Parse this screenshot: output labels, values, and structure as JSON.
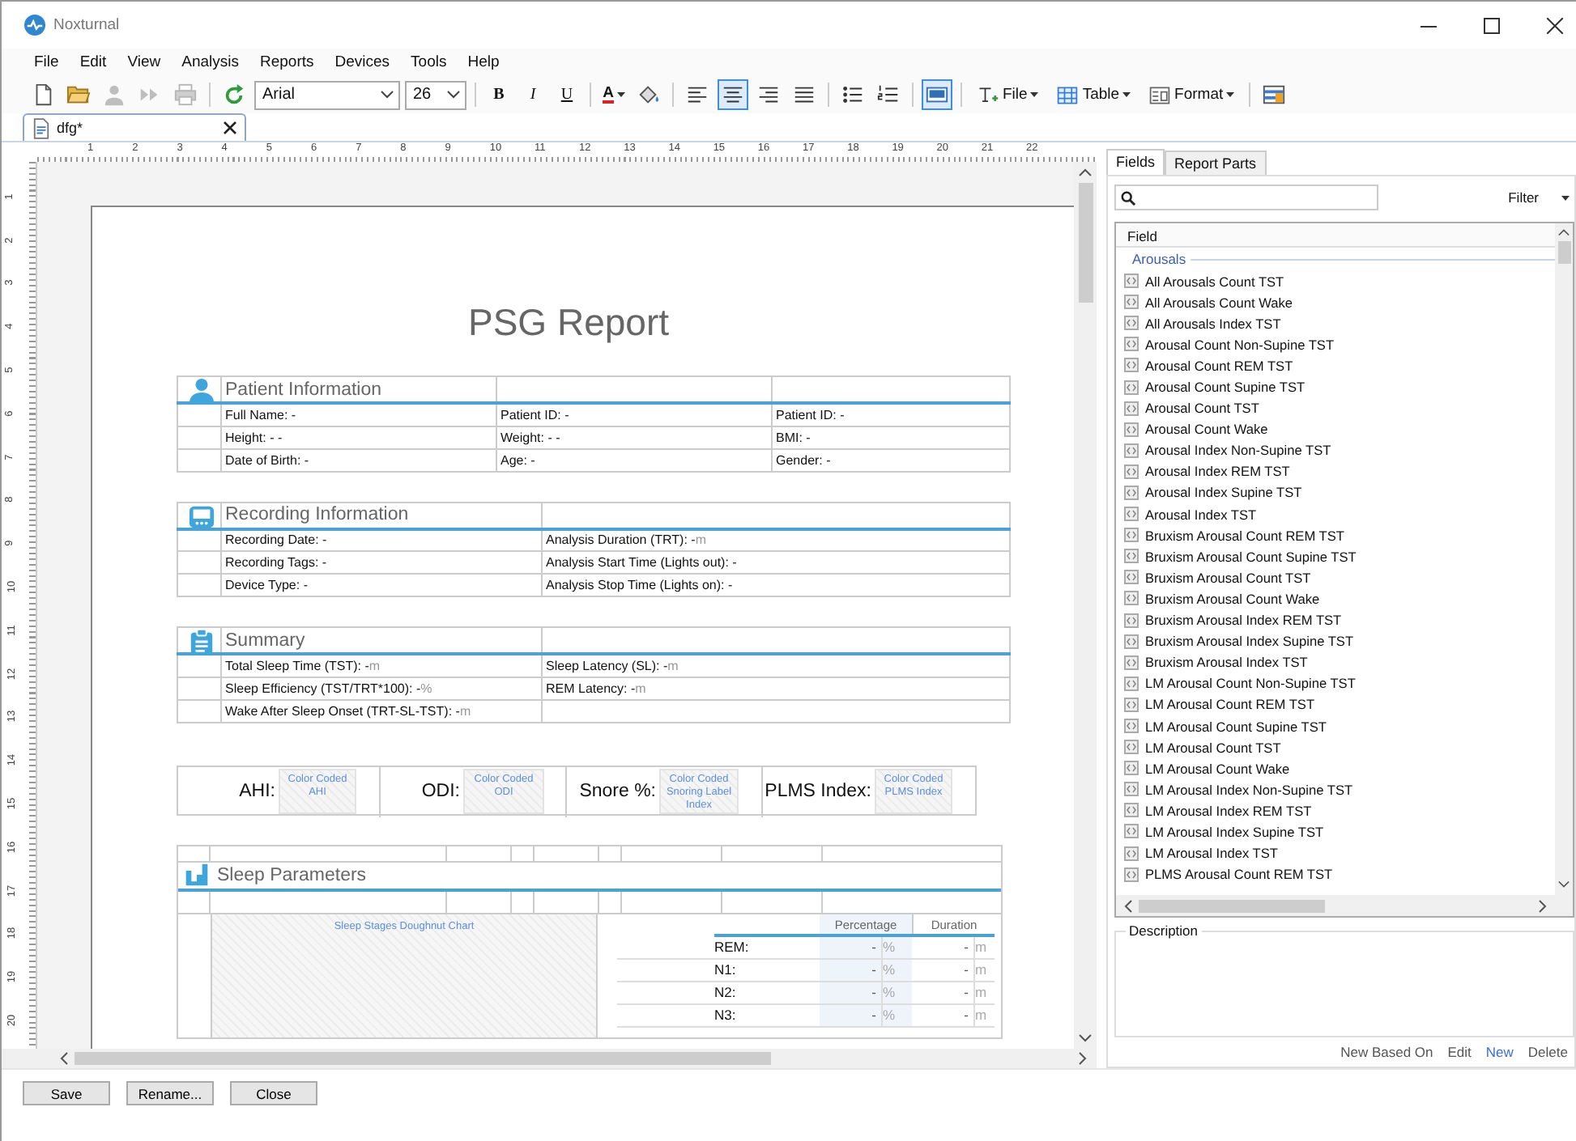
{
  "window": {
    "title": "Noxturnal"
  },
  "menu": [
    "File",
    "Edit",
    "View",
    "Analysis",
    "Reports",
    "Devices",
    "Tools",
    "Help"
  ],
  "toolbar": {
    "groups": [
      {
        "items": [
          {
            "kind": "new",
            "disabled": false
          },
          {
            "kind": "open",
            "disabled": false
          },
          {
            "kind": "person",
            "disabled": true
          },
          {
            "kind": "forward",
            "disabled": true
          },
          {
            "kind": "print",
            "disabled": true
          }
        ]
      },
      {
        "items": [
          {
            "kind": "redo",
            "disabled": false
          },
          {
            "kind": "select",
            "value": "Arial"
          },
          {
            "kind": "size",
            "value": "26"
          }
        ]
      },
      {
        "items": [
          {
            "kind": "bold",
            "label": "B"
          },
          {
            "kind": "italic",
            "label": "I"
          },
          {
            "kind": "underline",
            "label": "U"
          }
        ]
      },
      {
        "items": [
          {
            "kind": "color",
            "label": "A"
          },
          {
            "kind": "fill",
            "disabled": false
          }
        ]
      },
      {
        "items": [
          {
            "kind": "align-left",
            "selected": false
          },
          {
            "kind": "align-center",
            "selected": true
          },
          {
            "kind": "align-right",
            "selected": false
          },
          {
            "kind": "justify",
            "selected": false
          }
        ]
      },
      {
        "items": [
          {
            "kind": "bullets",
            "disabled": false
          },
          {
            "kind": "numbers",
            "disabled": false
          }
        ]
      },
      {
        "items": [
          {
            "kind": "view",
            "selected": true
          }
        ]
      },
      {
        "items": [
          {
            "kind": "menu",
            "label": "File"
          },
          {
            "kind": "menu",
            "label": "Table"
          },
          {
            "kind": "menu",
            "label": "Format"
          }
        ]
      },
      {
        "items": [
          {
            "kind": "columns",
            "disabled": false
          }
        ]
      }
    ]
  },
  "tabs": [
    {
      "label": "dfg*",
      "selected": true
    }
  ],
  "ruler": {
    "labels": [
      "1",
      "2",
      "3",
      "4",
      "5",
      "6",
      "7",
      "8",
      "9",
      "10",
      "11",
      "12",
      "13",
      "14",
      "15",
      "16",
      "17",
      "18",
      "19",
      "20",
      "21",
      "22"
    ],
    "vertical_labels": [
      "1",
      "2",
      "3",
      "4",
      "5",
      "6",
      "7",
      "8",
      "9",
      "10",
      "11",
      "12",
      "13",
      "14",
      "15",
      "16",
      "17",
      "18",
      "19",
      "20"
    ]
  },
  "report": {
    "title": "PSG Report",
    "sections": [
      {
        "kind": "patient",
        "title": "Patient Information",
        "rows": [
          [
            {
              "text": "Full Name: -"
            },
            {
              "text": "Patient ID: -"
            },
            {
              "text": "Patient ID: -"
            }
          ],
          [
            {
              "text": "Height: - -"
            },
            {
              "text": "Weight: - -"
            },
            {
              "text": "BMI: -"
            }
          ],
          [
            {
              "text": "Date of Birth: -"
            },
            {
              "text": "Age: -"
            },
            {
              "text": "Gender: -"
            }
          ]
        ]
      },
      {
        "kind": "recording",
        "title": "Recording Information",
        "rows": [
          [
            {
              "text": "Recording Date: -"
            },
            {
              "text": "Analysis Duration (TRT): -",
              "unit": "m"
            }
          ],
          [
            {
              "text": "Recording Tags: -"
            },
            {
              "text": "Analysis Start Time (Lights out): -"
            }
          ],
          [
            {
              "text": "Device Type: -"
            },
            {
              "text": "Analysis Stop Time (Lights on): -"
            }
          ]
        ]
      },
      {
        "kind": "summary",
        "title": "Summary",
        "rows": [
          [
            {
              "text": "Total Sleep Time (TST): -",
              "unit": "m"
            },
            {
              "text": "Sleep Latency (SL): -",
              "unit": "m"
            }
          ],
          [
            {
              "text": "Sleep Efficiency (TST/TRT*100): -",
              "unit": "%"
            },
            {
              "text": "REM Latency: -",
              "unit": "m"
            }
          ],
          [
            {
              "text": "Wake After Sleep Onset (TRT-SL-TST): -",
              "unit": "m"
            }
          ]
        ]
      }
    ],
    "indices": [
      {
        "label": "AHI:",
        "field": "Color Coded AHI"
      },
      {
        "label": "ODI:",
        "field": "Color Coded ODI"
      },
      {
        "label": "Snore %:",
        "field": "Color Coded Snoring Label Index"
      },
      {
        "label": "PLMS Index:",
        "field": "Color Coded PLMS Index"
      }
    ],
    "sleep": {
      "title": "Sleep Parameters",
      "chart_placeholder": "Sleep Stages Doughnut Chart",
      "headers": [
        "Percentage",
        "Duration"
      ],
      "rows": [
        {
          "stage": "REM:",
          "percentage": "-",
          "percent_unit": "%",
          "duration": "-",
          "duration_unit": "m"
        },
        {
          "stage": "N1:",
          "percentage": "-",
          "percent_unit": "%",
          "duration": "-",
          "duration_unit": "m"
        },
        {
          "stage": "N2:",
          "percentage": "-",
          "percent_unit": "%",
          "duration": "-",
          "duration_unit": "m"
        },
        {
          "stage": "N3:",
          "percentage": "-",
          "percent_unit": "%",
          "duration": "-",
          "duration_unit": "m"
        }
      ]
    }
  },
  "panel": {
    "tabs": [
      {
        "label": "Fields",
        "selected": true
      },
      {
        "label": "Report Parts",
        "selected": false
      }
    ],
    "filter": "Filter",
    "list_header": "Field",
    "groups": [
      {
        "name": "Arousals",
        "items": [
          "All Arousals Count TST",
          "All Arousals Count Wake",
          "All Arousals Index TST",
          "Arousal Count Non-Supine TST",
          "Arousal Count REM TST",
          "Arousal Count Supine TST",
          "Arousal Count TST",
          "Arousal Count Wake",
          "Arousal Index Non-Supine TST",
          "Arousal Index REM TST",
          "Arousal Index Supine TST",
          "Arousal Index TST",
          "Bruxism Arousal Count REM TST",
          "Bruxism Arousal Count Supine TST",
          "Bruxism Arousal Count TST",
          "Bruxism Arousal Count Wake",
          "Bruxism Arousal Index REM TST",
          "Bruxism Arousal Index Supine TST",
          "Bruxism Arousal Index TST",
          "LM Arousal Count Non-Supine TST",
          "LM Arousal Count REM TST",
          "LM Arousal Count Supine TST",
          "LM Arousal Count TST",
          "LM Arousal Count Wake",
          "LM Arousal Index Non-Supine TST",
          "LM Arousal Index REM TST",
          "LM Arousal Index Supine TST",
          "LM Arousal Index TST",
          "PLMS Arousal Count REM TST"
        ]
      }
    ],
    "description_title": "Description",
    "actions": [
      {
        "label": "New Based On",
        "highlighted": false
      },
      {
        "label": "Edit",
        "highlighted": false
      },
      {
        "label": "New",
        "highlighted": true
      },
      {
        "label": "Delete",
        "highlighted": false
      }
    ]
  },
  "buttons": [
    "Save",
    "Rename...",
    "Close"
  ]
}
